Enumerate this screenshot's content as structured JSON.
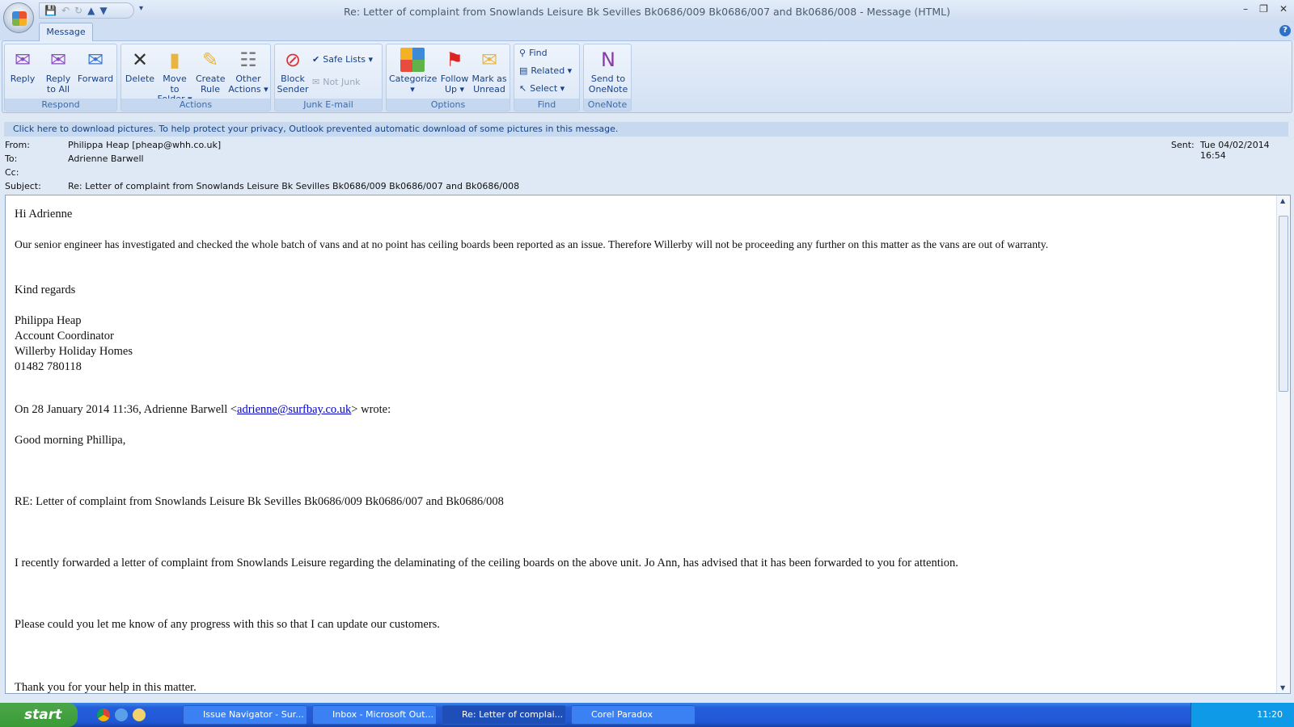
{
  "window": {
    "title": "Re: Letter of complaint from Snowlands Leisure Bk Sevilles Bk0686/009 Bk0686/007 and Bk0686/008 - Message (HTML)"
  },
  "ribbon": {
    "tab": "Message",
    "groups": {
      "respond": "Respond",
      "actions": "Actions",
      "junk": "Junk E-mail",
      "options": "Options",
      "find": "Find",
      "onenote": "OneNote"
    },
    "buttons": {
      "reply": "Reply",
      "reply_all": "Reply to All",
      "forward": "Forward",
      "delete": "Delete",
      "move": "Move to Folder ▾",
      "rule": "Create Rule",
      "other": "Other Actions ▾",
      "block": "Block Sender",
      "safe": "Safe Lists ▾",
      "notjunk": "Not Junk",
      "categorize": "Categorize ▾",
      "follow": "Follow Up ▾",
      "mark": "Mark as Unread",
      "find": "Find",
      "related": "Related ▾",
      "select": "Select ▾",
      "onenote": "Send to OneNote"
    }
  },
  "infobar": "Click here to download pictures. To help protect your privacy, Outlook prevented automatic download of some pictures in this message.",
  "header": {
    "from_label": "From:",
    "from": "Philippa Heap [pheap@whh.co.uk]",
    "to_label": "To:",
    "to": "Adrienne Barwell",
    "cc_label": "Cc:",
    "cc": "",
    "subject_label": "Subject:",
    "subject": "Re: Letter of complaint from Snowlands Leisure Bk Sevilles Bk0686/009 Bk0686/007 and Bk0686/008",
    "sent_label": "Sent:",
    "sent": "Tue 04/02/2014 16:54"
  },
  "body": {
    "greeting": "Hi Adrienne",
    "p1": "Our senior engineer has investigated and checked the whole batch of vans and at no point has ceiling boards been reported as an issue.  Therefore Willerby will not be proceeding any further on this matter as the vans are out of warranty.",
    "regards": "Kind regards",
    "sig1": "Philippa Heap",
    "sig2": "Account Coordinator",
    "sig3": "Willerby Holiday Homes",
    "sig4": "01482 780118",
    "quote_pre": "On 28 January 2014 11:36, Adrienne Barwell <",
    "quote_email": "adrienne@surfbay.co.uk",
    "quote_post": "> wrote:",
    "q_greet": "Good morning Phillipa,",
    "q_re": "RE: Letter of complaint from Snowlands Leisure Bk Sevilles Bk0686/009 Bk0686/007 and Bk0686/008",
    "q_p1": "I recently forwarded a letter of complaint from Snowlands Leisure regarding the delaminating of the ceiling boards on the above unit. Jo Ann, has advised that it has been forwarded to you for attention.",
    "q_p2": "Please could you let me know of any progress with this so that I can update our customers.",
    "q_p3": "Thank you for your help in this matter."
  },
  "taskbar": {
    "start": "start",
    "items": [
      "Issue Navigator - Sur...",
      "Inbox - Microsoft Out...",
      "Re: Letter of complai...",
      "Corel Paradox"
    ],
    "clock": "11:20"
  }
}
